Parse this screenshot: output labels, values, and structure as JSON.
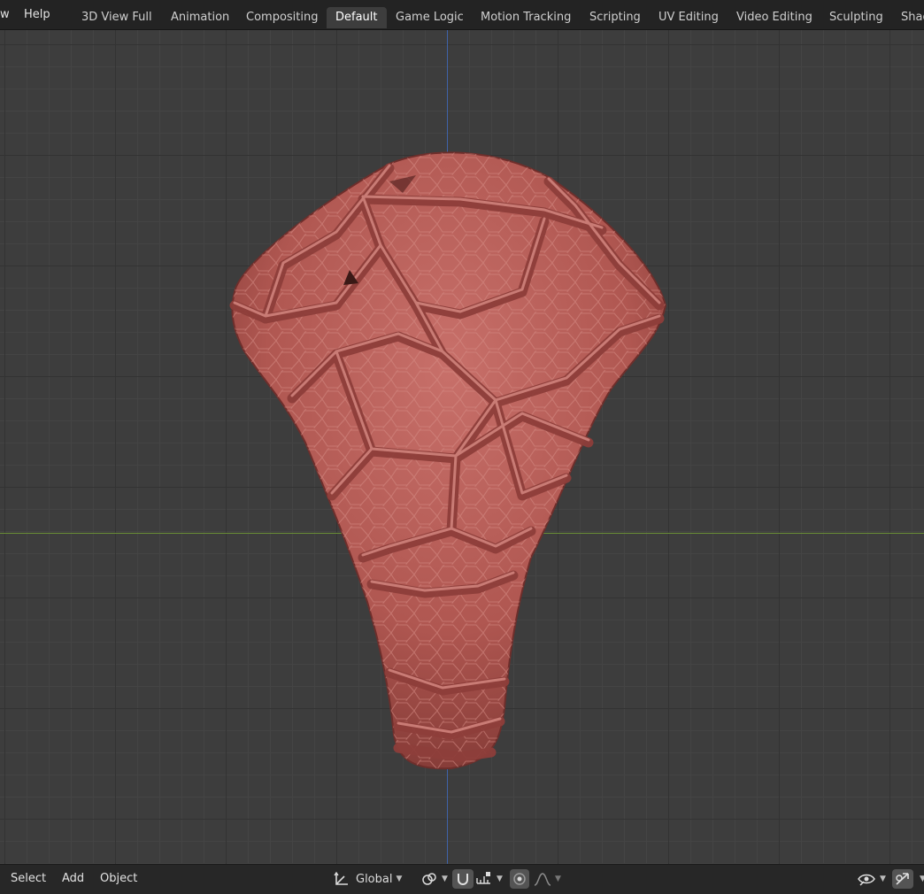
{
  "top_menu": {
    "partial_item": "w",
    "help": "Help"
  },
  "workspace_tabs": [
    {
      "label": "3D View Full"
    },
    {
      "label": "Animation"
    },
    {
      "label": "Compositing"
    },
    {
      "label": "Default"
    },
    {
      "label": "Game Logic"
    },
    {
      "label": "Motion Tracking"
    },
    {
      "label": "Scripting"
    },
    {
      "label": "UV Editing"
    },
    {
      "label": "Video Editing"
    },
    {
      "label": "Sculpting"
    },
    {
      "label": "Shad"
    }
  ],
  "active_tab": "Default",
  "viewport": {
    "object_color": "#b85a55",
    "grid_bg": "#3d3d3d",
    "axis_x_color": "#6a8e36",
    "axis_z_color": "#3f63a8"
  },
  "bottom_bar": {
    "menus": [
      "Select",
      "Add",
      "Object"
    ],
    "transform_orientation": "Global",
    "icons": {
      "orientation": "transform-orientation-icon",
      "pivot": "pivot-point-icon",
      "snap": "snap-magnet-icon",
      "snap_target": "snap-increment-icon",
      "proportional": "proportional-editing-icon",
      "falloff": "falloff-curve-icon",
      "visibility": "object-visibility-eye-icon",
      "gizmo": "gizmo-toggle-icon"
    }
  }
}
